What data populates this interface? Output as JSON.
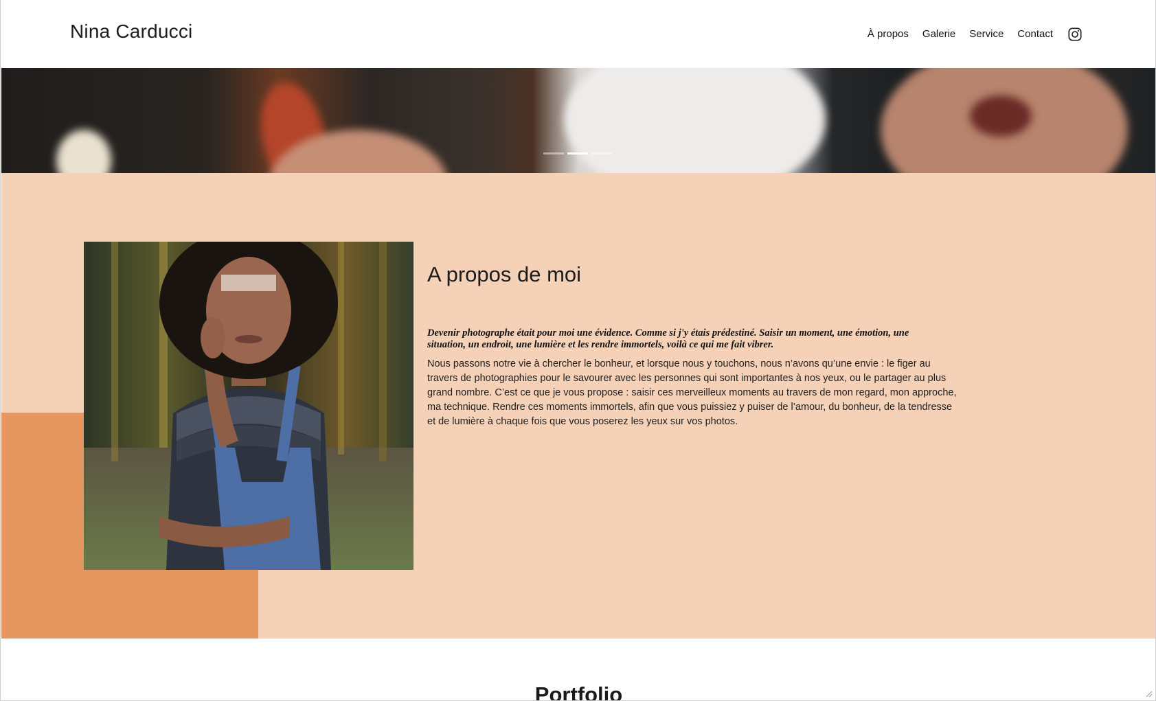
{
  "header": {
    "brand": "Nina Carducci",
    "nav": [
      {
        "label": "À propos"
      },
      {
        "label": "Galerie"
      },
      {
        "label": "Service"
      },
      {
        "label": "Contact"
      }
    ],
    "social_icon": "instagram-icon"
  },
  "hero": {
    "slide_count": 3,
    "active_slide": 2
  },
  "about": {
    "title": "A propos de moi",
    "lead": "Devenir photographe était pour moi une évidence. Comme si j'y étais prédestiné. Saisir un moment, une émotion, une situation, un endroit, une lumière et les rendre immortels, voilà ce qui me fait vibrer.",
    "body": "Nous passons notre vie à chercher le bonheur, et lorsque nous y touchons, nous n’avons qu’une envie : le figer au travers de photographies pour le savourer avec les personnes qui sont importantes à nos yeux, ou le partager au plus grand nombre. C’est ce que je vous propose : saisir ces merveilleux moments au travers de mon regard, mon approche, ma technique. Rendre ces moments immortels, afin que vous puissiez y puiser de l’amour, du bonheur, de la tendresse et de lumière à chaque fois que vous poserez les yeux sur vos photos."
  },
  "portfolio": {
    "title": "Portfolio"
  },
  "colors": {
    "about_bg": "#f5d1b7",
    "accent_block": "#e6965f",
    "header_bg": "#ffffff"
  }
}
